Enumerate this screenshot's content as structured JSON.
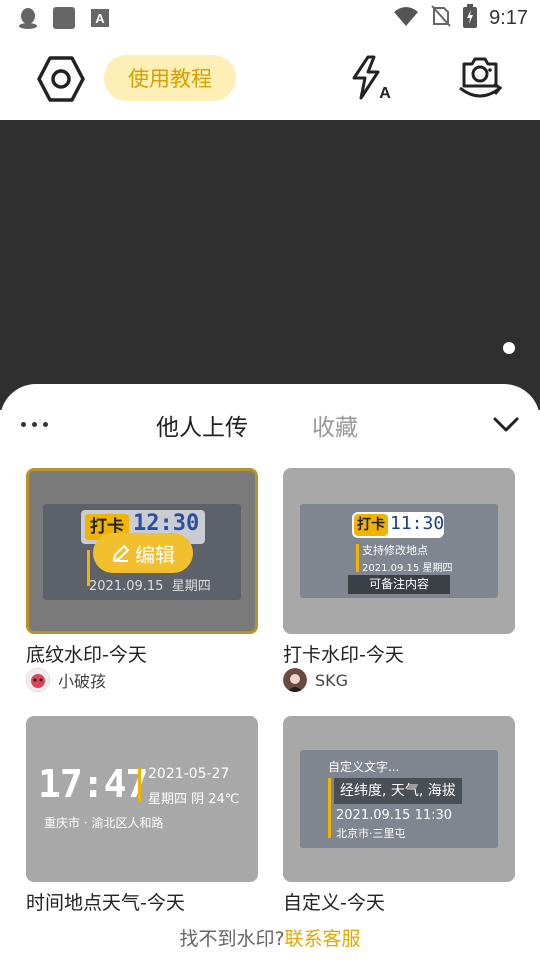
{
  "status_bar": {
    "time": "9:17",
    "icons": [
      "qq-icon",
      "app-square-icon",
      "text-a-icon",
      "wifi-icon",
      "no-sim-icon",
      "battery-charging-icon"
    ]
  },
  "toolbar": {
    "tutorial_label": "使用教程",
    "settings_icon": "settings-hex-icon",
    "flash_icon": "flash-auto-icon",
    "switch_camera_icon": "switch-camera-icon"
  },
  "sheet": {
    "tabs": [
      {
        "label": "他人上传",
        "active": true
      },
      {
        "label": "收藏",
        "active": false
      }
    ],
    "cards": [
      {
        "title": "底纹水印-今天",
        "author": "小破孩",
        "selected": true,
        "edit_label": "编辑",
        "preview": {
          "badge": "打卡",
          "time": "12:30",
          "date": "2021.09.15",
          "weekday": "星期四"
        }
      },
      {
        "title": "打卡水印-今天",
        "author": "SKG",
        "preview": {
          "badge": "打卡",
          "time": "11:30",
          "line1": "支持修改地点",
          "date": "2021.09.15",
          "weekday": "星期四",
          "note": "可备注内容"
        }
      },
      {
        "title": "时间地点天气-今天",
        "preview": {
          "time": "17:47",
          "date": "2021-05-27",
          "info": "星期四 阴 24℃",
          "location": "重庆市 · 渝北区人和路"
        }
      },
      {
        "title": "自定义-今天",
        "preview": {
          "header": "自定义文字...",
          "highlight": "经纬度, 天气, 海拔",
          "datetime": "2021.09.15 11:30",
          "location": "北京市·三里屯"
        }
      }
    ]
  },
  "footer": {
    "question": "找不到水印?",
    "link": "联系客服"
  },
  "colors": {
    "accent": "#e3a900",
    "tutorial_bg": "#fdefb5",
    "preview_bg": "#2f2f2f",
    "selected_border": "#b8932a"
  }
}
